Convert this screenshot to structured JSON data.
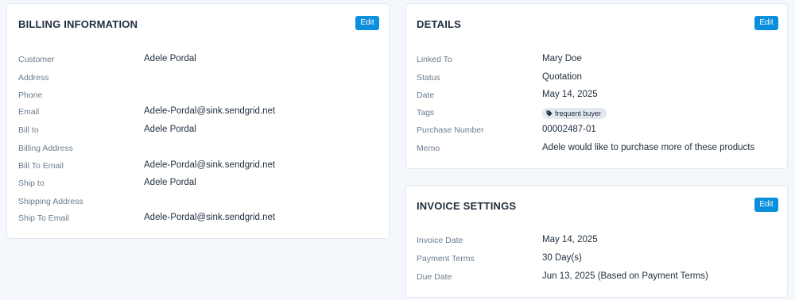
{
  "billing": {
    "title": "BILLING INFORMATION",
    "edit_label": "Edit",
    "rows": [
      {
        "label": "Customer",
        "value": "Adele Pordal"
      },
      {
        "label": "Address",
        "value": ""
      },
      {
        "label": "Phone",
        "value": ""
      },
      {
        "label": "Email",
        "value": "Adele-Pordal@sink.sendgrid.net"
      },
      {
        "label": "Bill to",
        "value": "Adele Pordal"
      },
      {
        "label": "Billing Address",
        "value": ""
      },
      {
        "label": "Bill To Email",
        "value": "Adele-Pordal@sink.sendgrid.net"
      },
      {
        "label": "Ship to",
        "value": "Adele Pordal"
      },
      {
        "label": "Shipping Address",
        "value": ""
      },
      {
        "label": "Ship To Email",
        "value": "Adele-Pordal@sink.sendgrid.net"
      }
    ]
  },
  "details": {
    "title": "DETAILS",
    "edit_label": "Edit",
    "rows": [
      {
        "label": "Linked To",
        "value": "Mary Doe"
      },
      {
        "label": "Status",
        "value": "Quotation"
      },
      {
        "label": "Date",
        "value": "May 14, 2025"
      },
      {
        "label": "Tags",
        "tag": "frequent buyer",
        "tag_icon": "tag-icon"
      },
      {
        "label": "Purchase Number",
        "value": "00002487-01"
      },
      {
        "label": "Memo",
        "value": "Adele would like to purchase more of these products"
      }
    ]
  },
  "invoice_settings": {
    "title": "INVOICE SETTINGS",
    "edit_label": "Edit",
    "rows": [
      {
        "label": "Invoice Date",
        "value": "May 14, 2025"
      },
      {
        "label": "Payment Terms",
        "value": "30 Day(s)"
      },
      {
        "label": "Due Date",
        "value": "Jun 13, 2025 (Based on Payment Terms)"
      }
    ]
  },
  "colors": {
    "accent": "#0a8fdc",
    "background": "#f4f7fb",
    "label": "#6b7c8e",
    "text": "#1f2d3d"
  }
}
